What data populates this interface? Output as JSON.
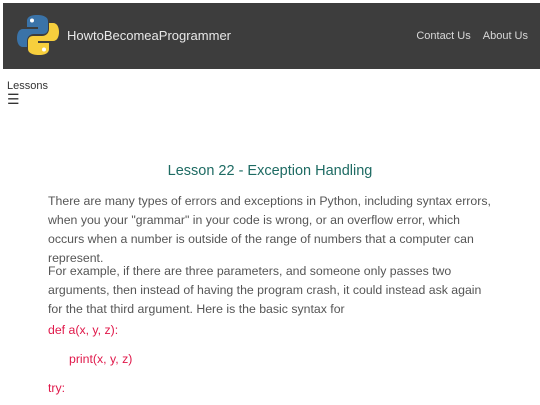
{
  "header": {
    "brand": "HowtoBecomeaProgrammer",
    "nav": [
      "Contact Us",
      "About Us"
    ]
  },
  "sidebar": {
    "label": "Lessons",
    "menu_icon": "☰"
  },
  "lesson": {
    "title": "Lesson 22 - Exception Handling",
    "paragraphs": [
      "There are many types of errors and exceptions in Python, including syntax errors, when you your \"grammar\" in your code is wrong, or an overflow error, which occurs when a number is outside of the range of numbers that a computer can represent.",
      "For example, if there are three parameters, and someone only passes two arguments, then instead of having the program crash, it could instead ask again for the that third argument. Here is the basic syntax for"
    ],
    "code_lines": [
      "def a(x, y, z):",
      "print(x, y, z)",
      "try:"
    ]
  },
  "colors": {
    "navbar_bg": "#3d3d3d",
    "title": "#1e6b63",
    "code": "#e0184a",
    "python_blue": "#3a73a8",
    "python_yellow": "#f7cf3d"
  },
  "icons": {
    "logo": "python-logo-icon",
    "menu": "hamburger-menu-icon"
  }
}
